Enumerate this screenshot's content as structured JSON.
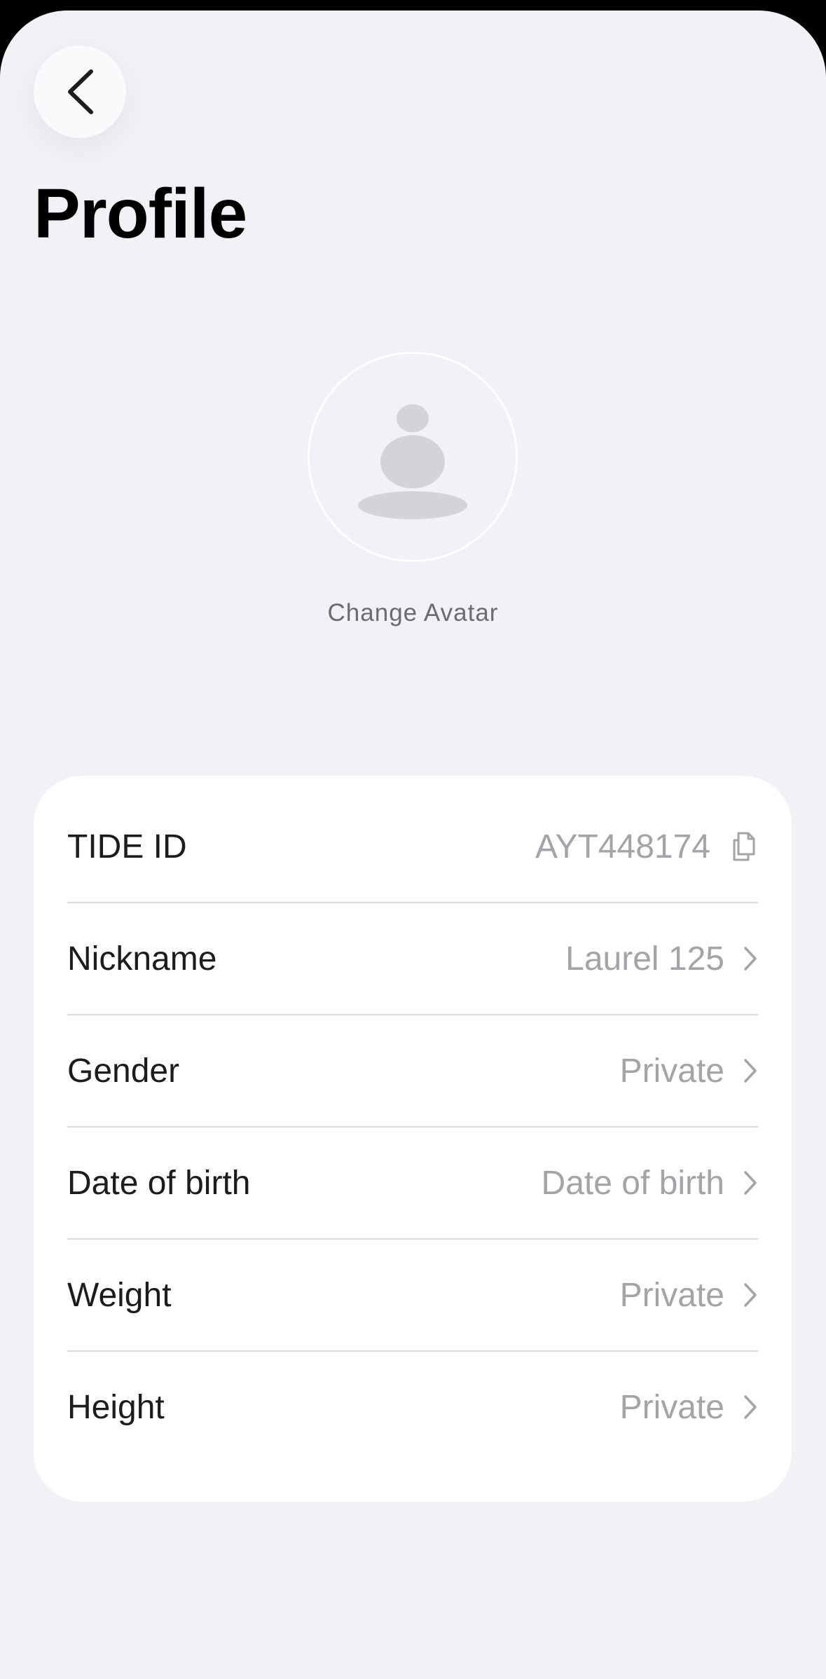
{
  "header": {
    "title": "Profile",
    "back_icon": "chevron-left-icon"
  },
  "avatar": {
    "icon": "person-placeholder-icon",
    "change_label": "Change Avatar"
  },
  "profile": {
    "tide_id": {
      "label": "TIDE ID",
      "value": "AYT448174",
      "icon": "copy-icon"
    },
    "rows": [
      {
        "key": "nickname",
        "label": "Nickname",
        "value": "Laurel 125"
      },
      {
        "key": "gender",
        "label": "Gender",
        "value": "Private"
      },
      {
        "key": "date-of-birth",
        "label": "Date of birth",
        "value": "Date of birth"
      },
      {
        "key": "weight",
        "label": "Weight",
        "value": "Private"
      },
      {
        "key": "height",
        "label": "Height",
        "value": "Private"
      }
    ]
  },
  "colors": {
    "background": "#f1f1f6",
    "card": "#ffffff",
    "label": "#1c1c1e",
    "value": "#a3a3a8",
    "placeholder_icon": "#d3d3d8"
  }
}
